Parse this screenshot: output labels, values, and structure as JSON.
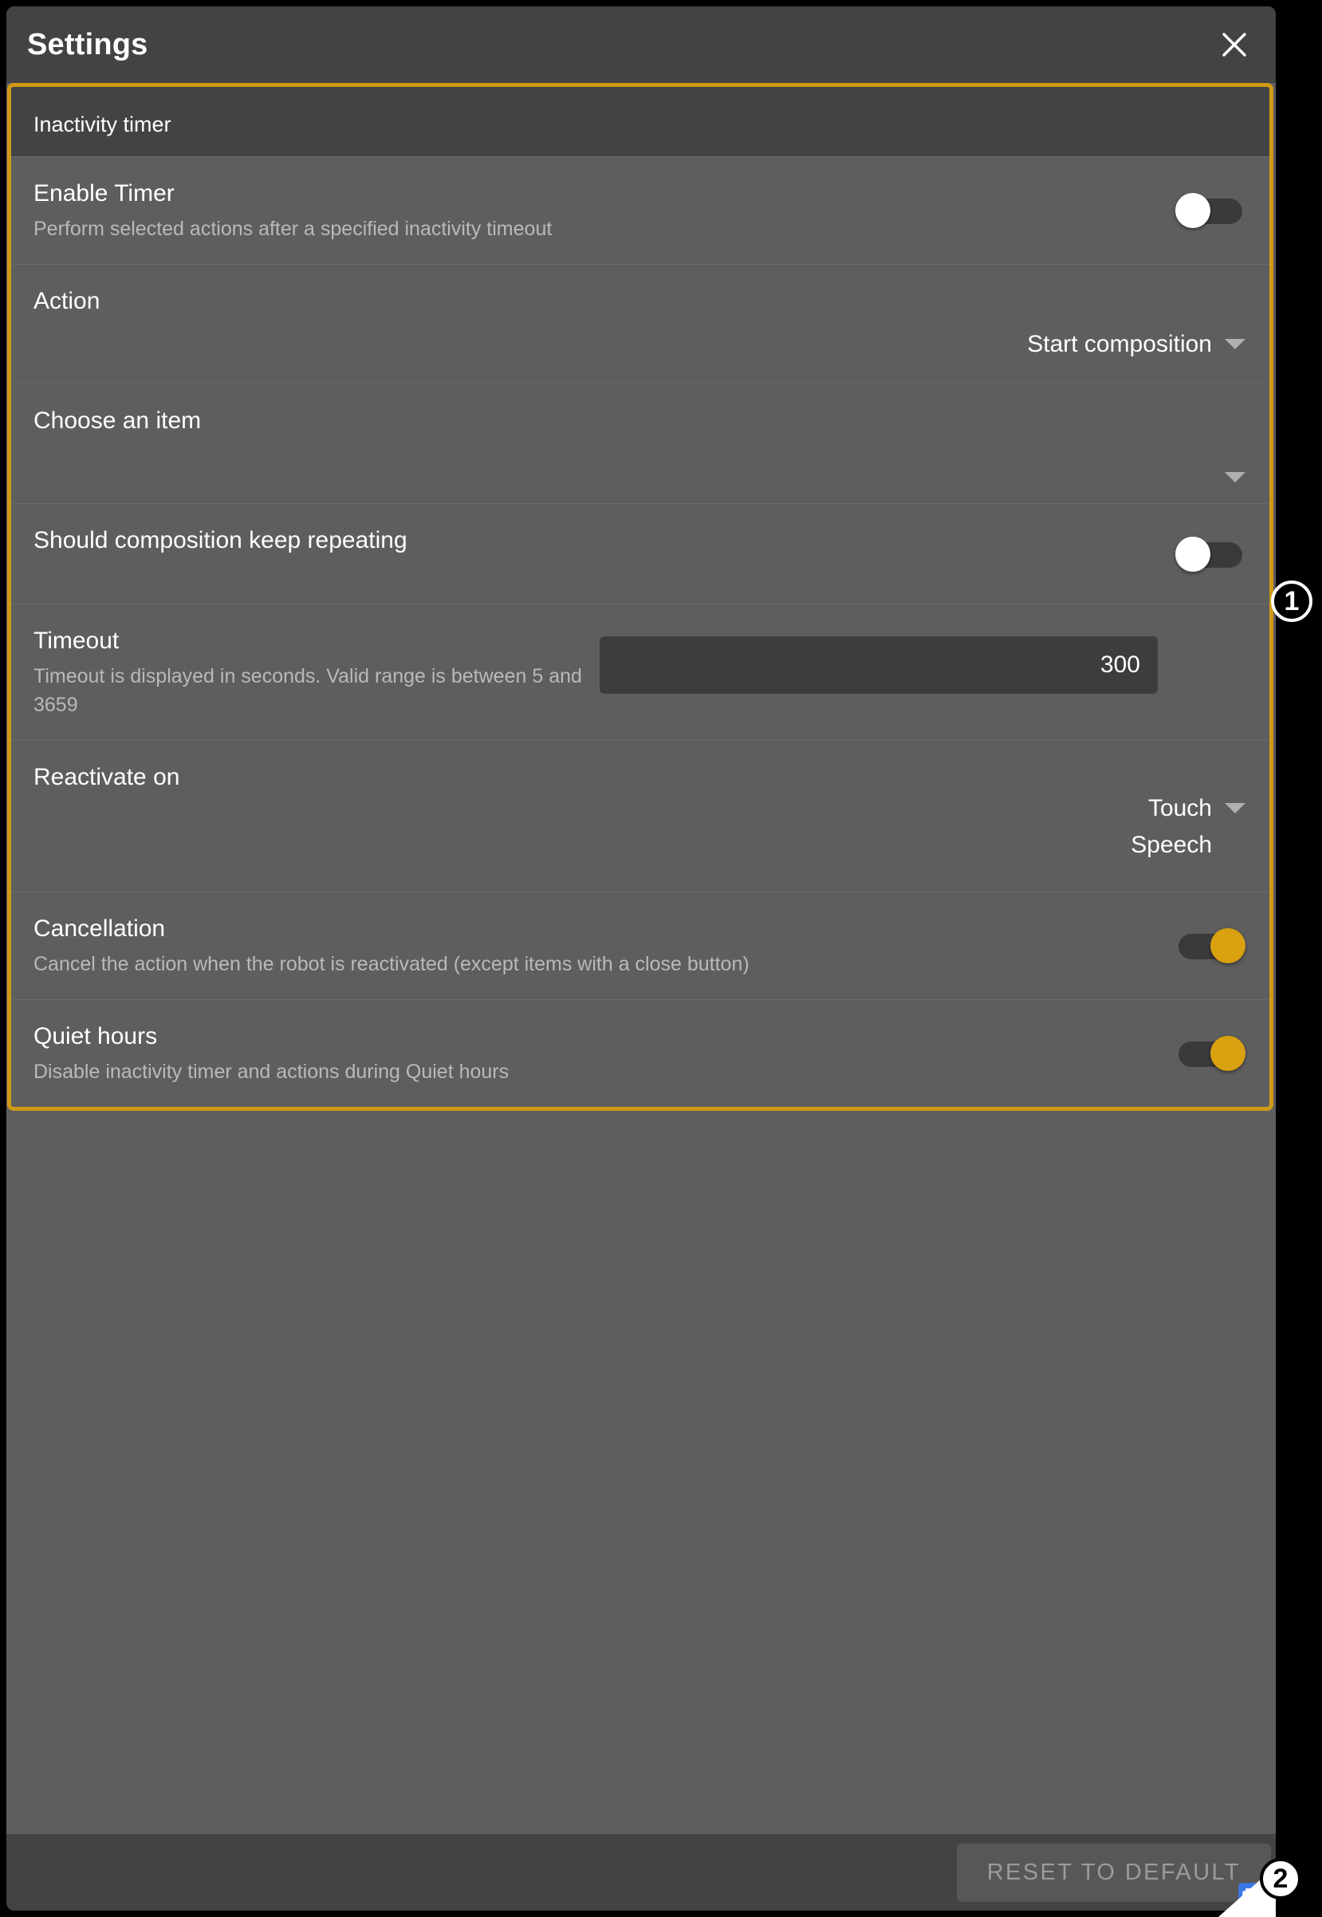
{
  "dialog": {
    "title": "Settings",
    "close_icon": "close-icon"
  },
  "section": {
    "header": "Inactivity timer"
  },
  "rows": [
    {
      "name": "enable-timer",
      "title": "Enable Timer",
      "subtitle": "Perform selected actions after a specified inactivity timeout",
      "control": "toggle",
      "state": "off"
    },
    {
      "name": "action",
      "title": "Action",
      "subtitle": "",
      "control": "dropdown",
      "value": "Start composition"
    },
    {
      "name": "choose-an-item",
      "title": "Choose an item",
      "subtitle": "",
      "control": "dropdown",
      "value": ""
    },
    {
      "name": "should-composition-keep-repeating",
      "title": "Should composition keep repeating",
      "subtitle": "",
      "control": "toggle",
      "state": "off"
    },
    {
      "name": "timeout",
      "title": "Timeout",
      "subtitle": "Timeout is displayed in seconds. Valid range is between 5 and 3659",
      "control": "input",
      "value": "300"
    },
    {
      "name": "reactivate-on",
      "title": "Reactivate on",
      "subtitle": "",
      "control": "dropdown-multi",
      "value_line1": "Touch",
      "value_line2": "Speech"
    },
    {
      "name": "cancellation",
      "title": "Cancellation",
      "subtitle": "Cancel the action when the robot is reactivated (except items with a close button)",
      "control": "toggle",
      "state": "on"
    },
    {
      "name": "quiet-hours",
      "title": "Quiet hours",
      "subtitle": "Disable inactivity timer and actions during Quiet hours",
      "control": "toggle",
      "state": "on"
    }
  ],
  "footer": {
    "reset_label": "RESET TO DEFAULT",
    "work_profile_icon": "briefcase-icon"
  },
  "annotations": [
    {
      "name": "annotation-marker-1",
      "label": "1"
    },
    {
      "name": "annotation-marker-2",
      "label": "2"
    }
  ],
  "colors": {
    "accent": "#d09a17",
    "toggle_on": "#d9a010",
    "panel_bg": "#5e5e5e",
    "bar_bg": "#434343",
    "work_profile_blue": "#3b78e7"
  }
}
